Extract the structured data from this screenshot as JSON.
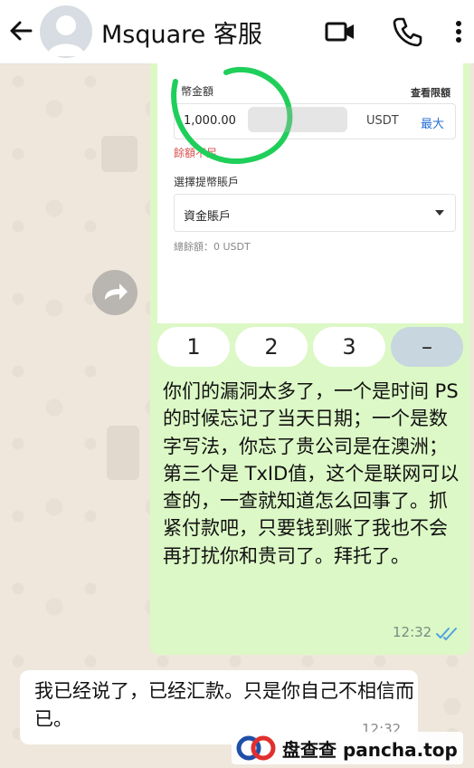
{
  "header": {
    "title": "Msquare 客服",
    "icons": [
      "back-arrow-icon",
      "avatar",
      "video-call-icon",
      "phone-icon",
      "more-vert-icon"
    ]
  },
  "screenshot": {
    "amount_label": "幣金額",
    "view_limit": "查看限額",
    "amount_value": "1,000.00",
    "currency": "USDT",
    "max": "最大",
    "error": "餘額不足",
    "account_label": "選擇提幣賬戶",
    "account_value": "資金賬戶",
    "balance": "總餘額：0 USDT",
    "keys": [
      "1",
      "2",
      "3",
      "–"
    ]
  },
  "messages": [
    {
      "direction": "out",
      "text": "你们的漏洞太多了，一个是时间 PS的时候忘记了当天日期；一个是数字写法，你忘了贵公司是在澳洲；第三个是 TxID值，这个是联网可以查的，一查就知道怎么回事了。抓紧付款吧，只要钱到账了我也不会再打扰你和贵司了。拜托了。",
      "time": "12:32",
      "status": "read"
    },
    {
      "direction": "in",
      "text": "我已经说了，已经汇款。只是你自己不相信而已。",
      "time": "12:32"
    }
  ],
  "watermark": {
    "text": "盘查查 pancha.top"
  },
  "colors": {
    "outgoing": "#dcf8c6",
    "incoming": "#ffffff",
    "wallpaper": "#efe7dc",
    "error": "#d9534f",
    "link": "#2a6fd6",
    "ticks": "#4fa3e0"
  }
}
